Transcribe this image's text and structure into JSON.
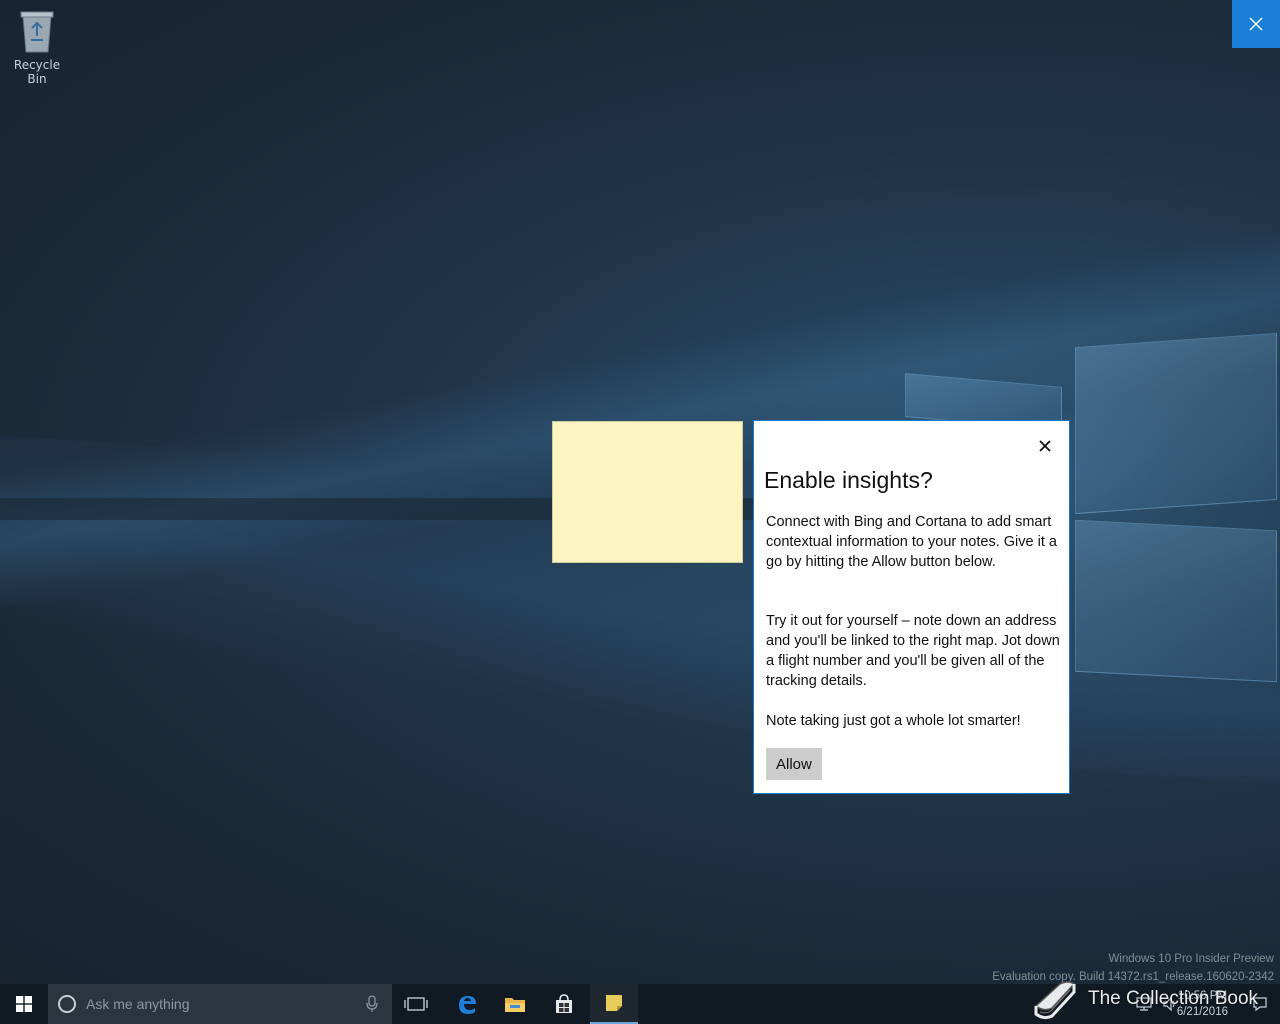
{
  "desktop": {
    "recycle_bin_label": "Recycle Bin",
    "watermark_line1": "Windows 10 Pro Insider Preview",
    "watermark_line2": "Evaluation copy. Build 14372.rs1_release.160620-2342"
  },
  "dialog": {
    "title": "Enable insights?",
    "para1": "Connect with Bing and Cortana to add smart contextual information to your notes. Give it a go by hitting the Allow button below.",
    "para2": "Try it out for yourself – note down an address and you'll be linked to the right map. Jot down a flight number and you'll be given all of the tracking details.",
    "para3": "Note taking just got a whole lot smarter!",
    "allow_label": "Allow"
  },
  "taskbar": {
    "search_placeholder": "Ask me anything",
    "clock_time": "10:56 PM",
    "clock_date": "6/21/2016"
  },
  "brand": {
    "text": "The Collection Book"
  },
  "colors": {
    "accent": "#1a7fd6",
    "sticky_note": "#fcf5c0",
    "taskbar": "#111a22",
    "allow_button": "#cccccc"
  },
  "icons": {
    "recycle_bin": "recycle-bin-icon",
    "close_corner": "close-icon",
    "dialog_close": "close-icon",
    "start": "windows-logo-icon",
    "cortana": "cortana-ring-icon",
    "mic": "microphone-icon",
    "task_view": "task-view-icon",
    "edge": "edge-browser-icon",
    "explorer": "folder-icon",
    "store": "store-icon",
    "sticky_notes": "sticky-notes-icon",
    "book": "book-icon"
  }
}
